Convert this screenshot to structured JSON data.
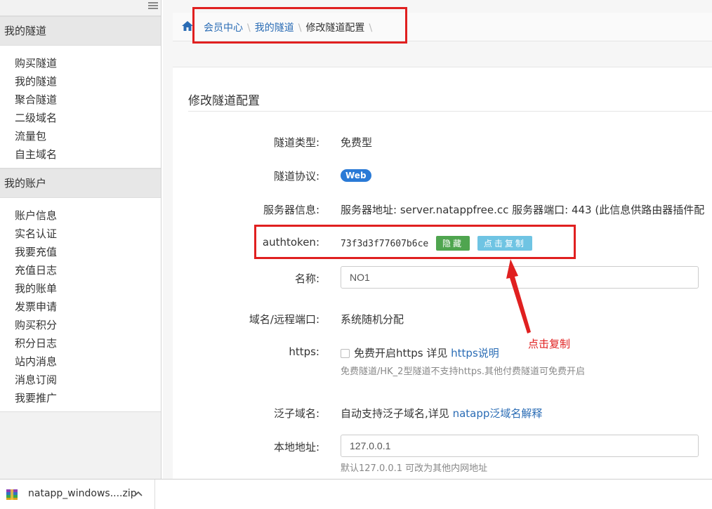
{
  "sidebar": {
    "sections": [
      {
        "title": "我的隧道",
        "items": [
          "购买隧道",
          "我的隧道",
          "聚合隧道",
          "二级域名",
          "流量包",
          "自主域名"
        ]
      },
      {
        "title": "我的账户",
        "items": [
          "账户信息",
          "实名认证",
          "我要充值",
          "充值日志",
          "我的账单",
          "发票申请",
          "购买积分",
          "积分日志",
          "站内消息",
          "消息订阅",
          "我要推广"
        ]
      }
    ],
    "menu_icon": "hamburger-icon"
  },
  "breadcrumb": {
    "home_icon": "home-icon",
    "items": [
      "会员中心",
      "我的隧道",
      "修改隧道配置"
    ]
  },
  "panel": {
    "title": "修改隧道配置"
  },
  "form": {
    "tunnel_type": {
      "label": "隧道类型:",
      "value": "免费型"
    },
    "protocol": {
      "label": "隧道协议:",
      "badge": "Web"
    },
    "server": {
      "label": "服务器信息:",
      "value": "服务器地址: server.natappfree.cc 服务器端口: 443 (此信息供路由器插件配"
    },
    "authtoken": {
      "label": "authtoken:",
      "value": "73f3d3f77607b6ce",
      "hide_button": "隐藏",
      "copy_button": "点击复制"
    },
    "name": {
      "label": "名称:",
      "value": "NO1"
    },
    "domain": {
      "label": "域名/远程端口:",
      "value": "系统随机分配"
    },
    "https": {
      "label": "https:",
      "checkbox_text": "免费开启https 详见",
      "link": "https说明",
      "help": "免费隧道/HK_2型隧道不支持https.其他付费隧道可免费开启"
    },
    "wildcard": {
      "label": "泛子域名:",
      "value": "自动支持泛子域名,详见",
      "link": "natapp泛域名解释"
    },
    "local_addr": {
      "label": "本地地址:",
      "value": "127.0.0.1",
      "help": "默认127.0.0.1 可改为其他内网地址"
    }
  },
  "annotation": {
    "text": "点击复制",
    "color": "#e02020"
  },
  "download": {
    "filename": "natapp_windows....zip",
    "icon": "zip-archive-icon"
  },
  "colors": {
    "link": "#2a6cb5",
    "badge": "#2a7ad6",
    "hide_btn": "#4fa54f",
    "copy_btn": "#6fc4e3",
    "annotation": "#e02020"
  }
}
